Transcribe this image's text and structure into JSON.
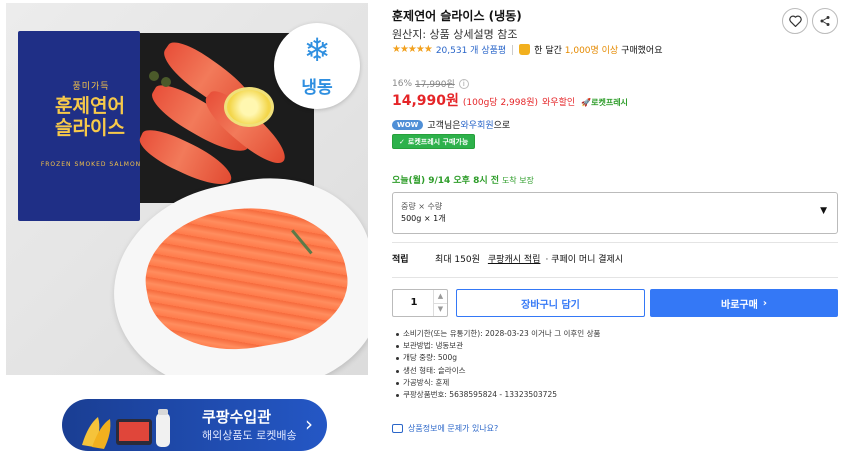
{
  "product_image": {
    "box_subtitle": "풍미가득",
    "box_title_line1": "훈제연어",
    "box_title_line2": "슬라이스",
    "box_english": "FROZEN SMOKED SALMON",
    "badge_text": "냉동",
    "badge_icon": "snowflake-icon"
  },
  "banner": {
    "title": "쿠팡수입관",
    "subtitle": "해외상품도 로켓배송",
    "arrow": "›"
  },
  "product": {
    "title": "훈제연어 슬라이스 (냉동)",
    "origin": "원산지: 상품 상세설명 참조",
    "stars": "★★★★★",
    "review_count": "20,531 개 상품평",
    "bought_prefix": "한 달간",
    "bought_count": "1,000명 이상",
    "bought_suffix": "구매했어요",
    "discount_rate": "16%",
    "original_price": "17,990원",
    "price": "14,990원",
    "unit_price": "(100g당 2,998원)",
    "wow_discount": "와우할인",
    "rocket_fresh_label": "로켓프레시",
    "wow_badge": "WOW",
    "wow_text_prefix": "고객님은",
    "wow_link": "와우회원",
    "wow_text_suffix": "으로",
    "fresh_badge": "로켓프레시 구매가능",
    "delivery_day": "오늘(월) 9/14 오후 8시 전",
    "delivery_guarantee": "도착 보장"
  },
  "option": {
    "label": "중량 × 수량",
    "value": "500g × 1개"
  },
  "reward": {
    "label": "적립",
    "max": "최대 150원",
    "link": "쿠팡캐시 적립",
    "extra": "· 쿠페이 머니 결제시"
  },
  "purchase": {
    "quantity": "1",
    "cart_label": "장바구니 담기",
    "buy_label": "바로구매",
    "buy_arrow": "›"
  },
  "specs": [
    "소비기한(또는 유통기한): 2028-03-23 이거나 그 이후인 상품",
    "보관방법: 냉동보관",
    "개당 중량: 500g",
    "생선 형태: 슬라이스",
    "가공방식: 훈제",
    "쿠팡상품번호: 5638595824 - 13323503725"
  ],
  "report_link": "상품정보에 문제가 있나요?",
  "colors": {
    "price_red": "#e52528",
    "link_blue": "#2a66c9",
    "primary_blue": "#3478f6",
    "fresh_green": "#2e9d2a",
    "star_orange": "#f2a11f"
  }
}
